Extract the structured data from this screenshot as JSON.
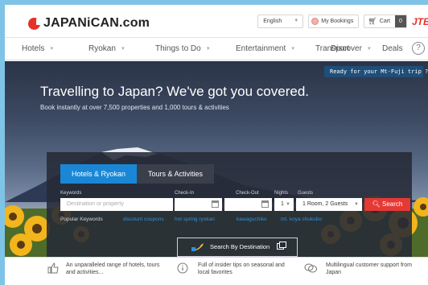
{
  "header": {
    "logo_text": "JAPANiCAN.com",
    "language": "English",
    "bookings_label": "My Bookings",
    "cart_label": "Cart",
    "cart_count": "0",
    "partner_logo": "JTB"
  },
  "nav": {
    "items": [
      {
        "label": "Hotels",
        "has_dropdown": true
      },
      {
        "label": "Ryokan",
        "has_dropdown": true
      },
      {
        "label": "Things to Do",
        "has_dropdown": true
      },
      {
        "label": "Entertainment",
        "has_dropdown": true
      },
      {
        "label": "Transport",
        "has_dropdown": false
      },
      {
        "label": "Discover",
        "has_dropdown": true
      },
      {
        "label": "Deals",
        "has_dropdown": false
      }
    ],
    "help_symbol": "?"
  },
  "hero": {
    "banner": "Ready for your Mt-Fuji trip ? ➤",
    "title": "Travelling to Japan? We've got you covered.",
    "subtitle": "Book instantly at over 7,500 properties and 1,000 tours & activities"
  },
  "search": {
    "tabs": [
      {
        "label": "Hotels & Ryokan",
        "active": true
      },
      {
        "label": "Tours & Activities",
        "active": false
      }
    ],
    "keywords_label": "Keywords",
    "keywords_placeholder": "Destination or property",
    "checkin_label": "Check-In",
    "checkout_label": "Check-Out",
    "nights_label": "Nights",
    "nights_value": "1",
    "guests_label": "Guests",
    "guests_value": "1 Room, 2 Guests",
    "search_button": "Search",
    "popular_label": "Popular Keywords",
    "popular_keywords": [
      "discount coupons",
      "hot spring ryokan",
      "kawaguchiko",
      "mt. koya shukubo"
    ],
    "destination_button": "Search By Destination"
  },
  "features": [
    {
      "text_line1": "An unparalleled range of hotels, tours",
      "text_line2": "and activities..."
    },
    {
      "text_line1": "Full of insider tips on seasonal and",
      "text_line2": "local favorites"
    },
    {
      "text_line1": "Multilingual customer support from",
      "text_line2": "Japan"
    }
  ],
  "colors": {
    "brand_red": "#e5312a",
    "tab_active": "#1a87d6",
    "search_red": "#e53935",
    "keyword_link": "#2f8fe0",
    "banner_blue": "#1f4e79"
  }
}
